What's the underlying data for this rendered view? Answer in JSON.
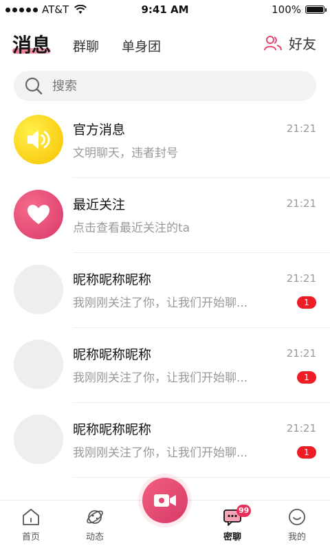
{
  "status_bar": {
    "carrier": "AT&T",
    "time": "9:41 AM",
    "battery": "100%"
  },
  "top_nav": {
    "tabs": [
      {
        "label": "消息",
        "active": true
      },
      {
        "label": "群聊",
        "active": false
      },
      {
        "label": "单身团",
        "active": false
      }
    ],
    "friends_label": "好友"
  },
  "search": {
    "placeholder": "搜索"
  },
  "conversations": [
    {
      "title": "官方消息",
      "subtitle": "文明聊天，违者封号",
      "time": "21:21",
      "badge": "",
      "icon": "speaker-icon"
    },
    {
      "title": "最近关注",
      "subtitle": "点击查看最近关注的ta",
      "time": "21:21",
      "badge": "",
      "icon": "heart-icon"
    },
    {
      "title": "昵称昵称昵称",
      "subtitle": "我刚刚关注了你，让我们开始聊...",
      "time": "21:21",
      "badge": "1"
    },
    {
      "title": "昵称昵称昵称",
      "subtitle": "我刚刚关注了你，让我们开始聊...",
      "time": "21:21",
      "badge": "1"
    },
    {
      "title": "昵称昵称昵称",
      "subtitle": "我刚刚关注了你，让我们开始聊...",
      "time": "21:21",
      "badge": "1"
    }
  ],
  "tab_bar": {
    "items": [
      {
        "label": "首页",
        "icon": "home-icon"
      },
      {
        "label": "动态",
        "icon": "planet-icon"
      },
      {
        "label": "密聊",
        "icon": "chat-icon",
        "badge": "99",
        "active": true
      },
      {
        "label": "我的",
        "icon": "smile-icon"
      }
    ],
    "center_icon": "video-camera-icon"
  },
  "colors": {
    "accent": "#e8466f",
    "badge": "#ee1c24",
    "official": "#f7c100"
  }
}
